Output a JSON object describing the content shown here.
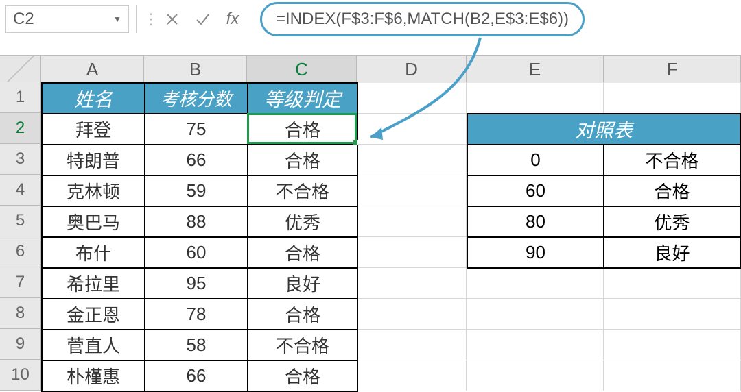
{
  "formula_bar": {
    "name_box": "C2",
    "formula": "=INDEX(F$3:F$6,MATCH(B2,E$3:E$6))",
    "fx_label": "fx"
  },
  "columns": [
    "A",
    "B",
    "C",
    "D",
    "E",
    "F"
  ],
  "rows": [
    "1",
    "2",
    "3",
    "4",
    "5",
    "6",
    "7",
    "8",
    "9",
    "10"
  ],
  "main_table": {
    "headers": {
      "A": "姓名",
      "B": "考核分数",
      "C": "等级判定"
    },
    "rows": [
      {
        "A": "拜登",
        "B": "75",
        "C": "合格"
      },
      {
        "A": "特朗普",
        "B": "66",
        "C": "合格"
      },
      {
        "A": "克林顿",
        "B": "59",
        "C": "不合格"
      },
      {
        "A": "奥巴马",
        "B": "88",
        "C": "优秀"
      },
      {
        "A": "布什",
        "B": "60",
        "C": "合格"
      },
      {
        "A": "希拉里",
        "B": "95",
        "C": "良好"
      },
      {
        "A": "金正恩",
        "B": "78",
        "C": "合格"
      },
      {
        "A": "菅直人",
        "B": "58",
        "C": "不合格"
      },
      {
        "A": "朴槿惠",
        "B": "66",
        "C": "合格"
      }
    ]
  },
  "lookup_table": {
    "title": "对照表",
    "rows": [
      {
        "E": "0",
        "F": "不合格"
      },
      {
        "E": "60",
        "F": "合格"
      },
      {
        "E": "80",
        "F": "优秀"
      },
      {
        "E": "90",
        "F": "良好"
      }
    ]
  },
  "active_cell_ref": "C2"
}
